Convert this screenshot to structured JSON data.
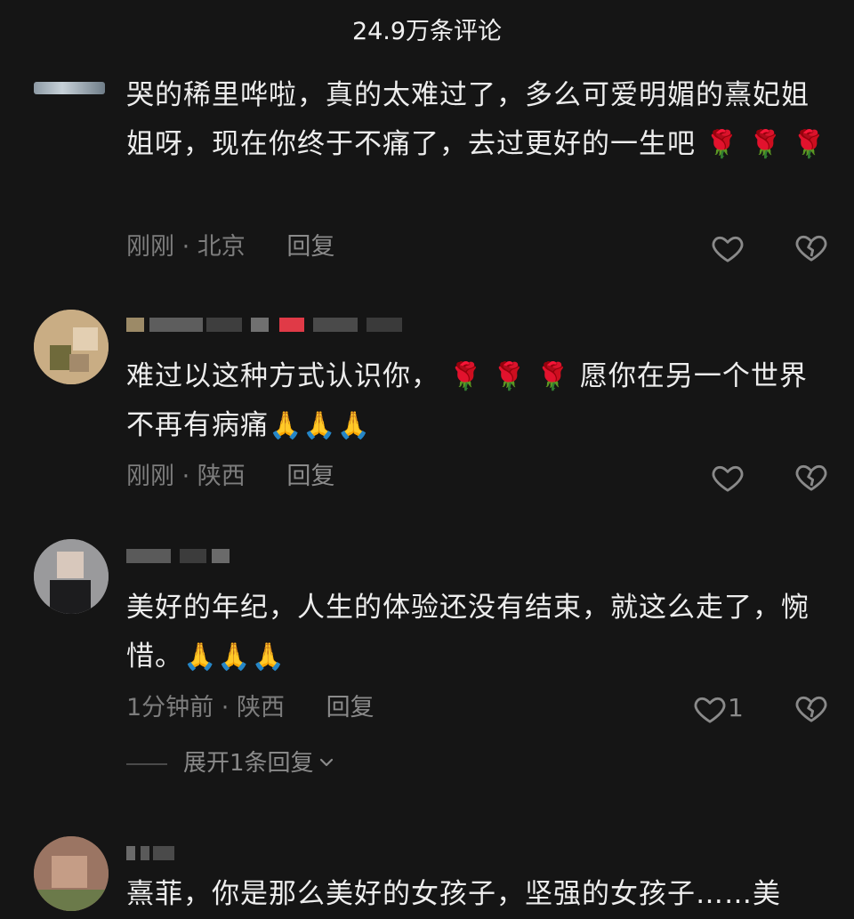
{
  "header": {
    "title": "24.9万条评论"
  },
  "comments": [
    {
      "text": "哭的稀里哗啦，真的太难过了，多么可爱明媚的熹妃姐姐呀，现在你终于不痛了，去过更好的一生吧",
      "emoji": "🌹 🌹 🌹",
      "time": "刚刚",
      "sep": "·",
      "location": "北京",
      "reply": "回复"
    },
    {
      "text_a": "难过以这种方式认识你，",
      "emoji_a": "🌹 🌹 🌹",
      "text_b": "愿你在另一个世界不再有病痛",
      "emoji_b": "🙏🙏🙏",
      "time": "刚刚",
      "sep": "·",
      "location": "陕西",
      "reply": "回复"
    },
    {
      "text": "美好的年纪，人生的体验还没有结束，就这么走了，惋惜。",
      "emoji": "🙏🙏🙏",
      "time": "1分钟前",
      "sep": "·",
      "location": "陕西",
      "reply": "回复",
      "likes": "1",
      "expand": "展开1条回复"
    },
    {
      "text": "熹菲，你是那么美好的女孩子，坚强的女孩子……美"
    }
  ],
  "icons": {
    "like": "heart-outline-icon",
    "dislike": "broken-heart-icon",
    "expand": "chevron-down-icon"
  },
  "colors": {
    "background": "#151515",
    "text": "#ededed",
    "meta": "#7d7d7d",
    "rose": "#e03a47"
  }
}
